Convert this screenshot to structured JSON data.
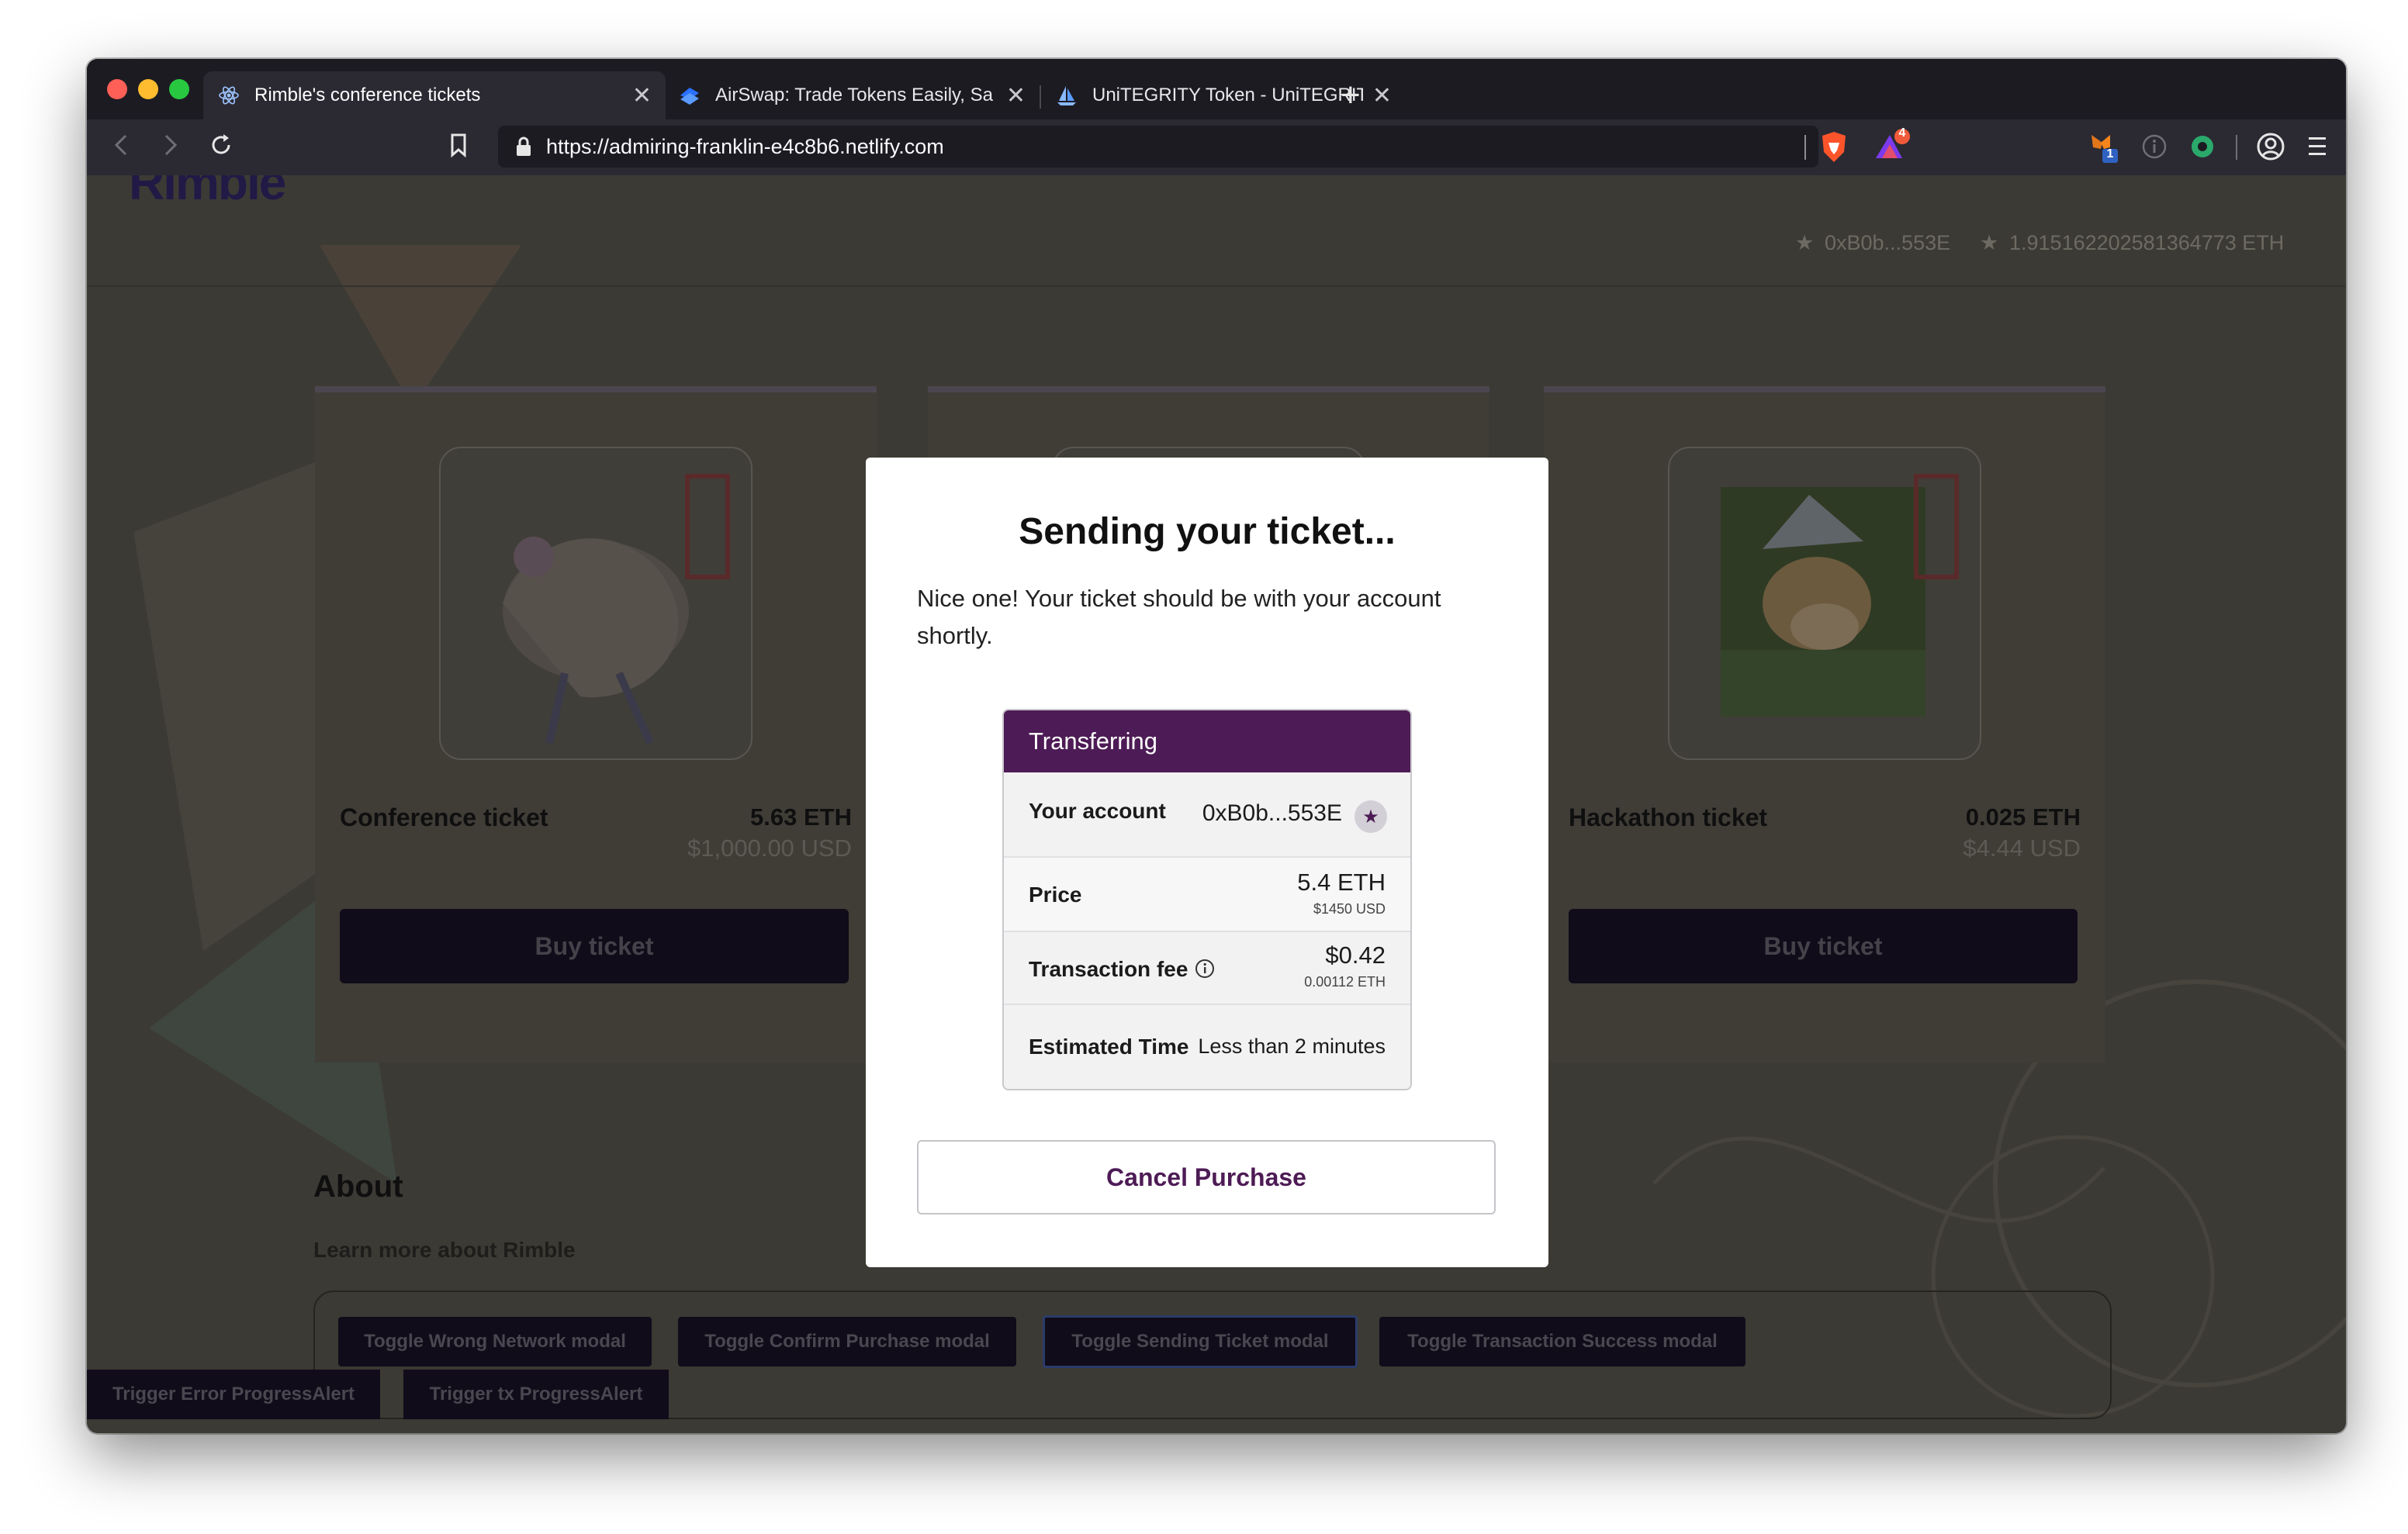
{
  "browser": {
    "tabs": [
      {
        "title": "Rimble's conference tickets",
        "close": "✕"
      },
      {
        "title": "AirSwap: Trade Tokens Easily, Sa",
        "close": "✕"
      },
      {
        "title": "UniTEGRITY Token - UniTEGRITY",
        "close": "✕"
      }
    ],
    "new_tab": "+",
    "url": "https://admiring-franklin-e4c8b6.netlify.com",
    "alert_badge": "4",
    "ext_badge": "1",
    "colors": {
      "tab_bg": "#1c1b22",
      "toolbar_bg": "#2b2a33"
    }
  },
  "site": {
    "brand": "Rimble",
    "account_short": "0xB0b...553E",
    "balance": "1.915162202581364773 ETH"
  },
  "cards": [
    {
      "name": "Conference ticket",
      "eth": "5.63 ETH",
      "usd": "$1,000.00 USD",
      "button": "Buy ticket"
    },
    {
      "name": "Hackathon ticket",
      "eth": "0.025 ETH",
      "usd": "$4.44 USD",
      "button": "Buy ticket"
    }
  ],
  "about": {
    "title": "About",
    "subtitle": "Learn more about Rimble",
    "toggles": [
      "Toggle Wrong Network modal",
      "Toggle Confirm Purchase modal",
      "Toggle Sending Ticket modal",
      "Toggle Transaction Success modal"
    ],
    "triggers": [
      "Trigger Error ProgressAlert",
      "Trigger tx ProgressAlert"
    ]
  },
  "modal": {
    "title": "Sending your ticket...",
    "body": "Nice one! Your ticket should be with your account shortly.",
    "transfer": {
      "header": "Transferring",
      "account_label": "Your account",
      "account_value": "0xB0b...553E",
      "price_label": "Price",
      "price_eth": "5.4 ETH",
      "price_usd": "$1450 USD",
      "fee_label": "Transaction fee",
      "fee_usd": "$0.42",
      "fee_eth": "0.00112 ETH",
      "time_label": "Estimated Time",
      "time_value": "Less than 2 minutes"
    },
    "cancel_label": "Cancel Purchase",
    "accent": "#4d1b55"
  }
}
